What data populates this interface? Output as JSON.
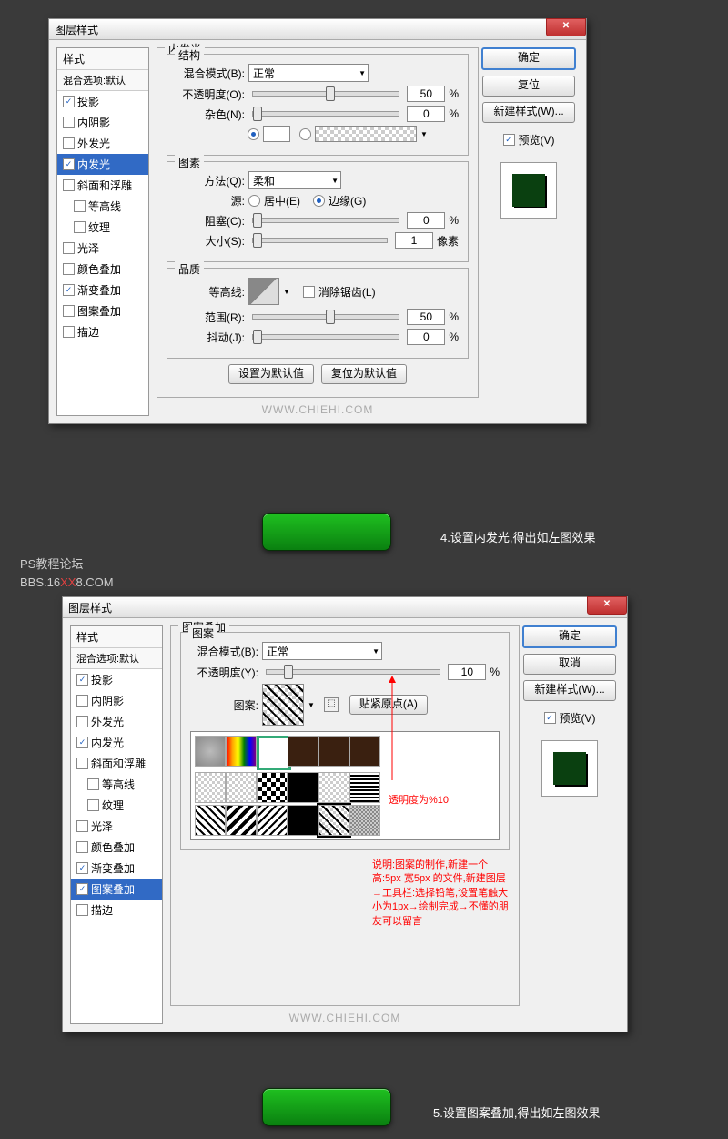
{
  "dialog1": {
    "title": "图层样式",
    "styles_header": "样式",
    "blend_options": "混合选项:默认",
    "items": [
      {
        "label": "投影",
        "checked": true,
        "sel": false
      },
      {
        "label": "内阴影",
        "checked": false,
        "sel": false
      },
      {
        "label": "外发光",
        "checked": false,
        "sel": false
      },
      {
        "label": "内发光",
        "checked": true,
        "sel": true
      },
      {
        "label": "斜面和浮雕",
        "checked": false,
        "sel": false
      },
      {
        "label": "等高线",
        "checked": false,
        "sel": false,
        "indent": true
      },
      {
        "label": "纹理",
        "checked": false,
        "sel": false,
        "indent": true
      },
      {
        "label": "光泽",
        "checked": false,
        "sel": false
      },
      {
        "label": "颜色叠加",
        "checked": false,
        "sel": false
      },
      {
        "label": "渐变叠加",
        "checked": true,
        "sel": false
      },
      {
        "label": "图案叠加",
        "checked": false,
        "sel": false
      },
      {
        "label": "描边",
        "checked": false,
        "sel": false
      }
    ],
    "panel_title": "内发光",
    "struct_title": "结构",
    "blend_mode_label": "混合模式(B):",
    "blend_mode_value": "正常",
    "opacity_label": "不透明度(O):",
    "opacity_value": "50",
    "noise_label": "杂色(N):",
    "noise_value": "0",
    "element_title": "图素",
    "method_label": "方法(Q):",
    "method_value": "柔和",
    "source_label": "源:",
    "source_center": "居中(E)",
    "source_edge": "边缘(G)",
    "choke_label": "阻塞(C):",
    "choke_value": "0",
    "size_label": "大小(S):",
    "size_value": "1",
    "size_unit": "像素",
    "quality_title": "品质",
    "contour_label": "等高线:",
    "antialias_label": "消除锯齿(L)",
    "range_label": "范围(R):",
    "range_value": "50",
    "jitter_label": "抖动(J):",
    "jitter_value": "0",
    "percent": "%",
    "btn_default": "设置为默认值",
    "btn_reset": "复位为默认值",
    "watermark": "WWW.CHIEHI.COM",
    "ok": "确定",
    "reset_btn": "复位",
    "new_style": "新建样式(W)...",
    "preview_chk": "预览(V)"
  },
  "step4_caption": "4.设置内发光,得出如左图效果",
  "forum": {
    "line1": "PS教程论坛",
    "line2a": "BBS.16",
    "line2b": "XX",
    "line2c": "8.COM"
  },
  "dialog2": {
    "title": "图层样式",
    "styles_header": "样式",
    "blend_options": "混合选项:默认",
    "items": [
      {
        "label": "投影",
        "checked": true,
        "sel": false
      },
      {
        "label": "内阴影",
        "checked": false,
        "sel": false
      },
      {
        "label": "外发光",
        "checked": false,
        "sel": false
      },
      {
        "label": "内发光",
        "checked": true,
        "sel": false
      },
      {
        "label": "斜面和浮雕",
        "checked": false,
        "sel": false
      },
      {
        "label": "等高线",
        "checked": false,
        "sel": false,
        "indent": true
      },
      {
        "label": "纹理",
        "checked": false,
        "sel": false,
        "indent": true
      },
      {
        "label": "光泽",
        "checked": false,
        "sel": false
      },
      {
        "label": "颜色叠加",
        "checked": false,
        "sel": false
      },
      {
        "label": "渐变叠加",
        "checked": true,
        "sel": false
      },
      {
        "label": "图案叠加",
        "checked": true,
        "sel": true
      },
      {
        "label": "描边",
        "checked": false,
        "sel": false
      }
    ],
    "panel_title": "图案叠加",
    "pattern_title": "图案",
    "blend_mode_label": "混合模式(B):",
    "blend_mode_value": "正常",
    "opacity_label": "不透明度(Y):",
    "opacity_value": "10",
    "pattern_label": "图案:",
    "snap_origin": "贴紧原点(A)",
    "percent": "%",
    "watermark": "WWW.CHIEHI.COM",
    "ok": "确定",
    "cancel": "取消",
    "new_style": "新建样式(W)...",
    "preview_chk": "预览(V)",
    "note_opacity": "透明度为%10",
    "note_desc": "说明:图案的制作,新建一个高:5px 宽5px 的文件,新建图层→工具栏:选择铅笔,设置笔触大小为1px→绘制完成→不懂的朋友可以留言"
  },
  "step5_caption": "5.设置图案叠加,得出如左图效果"
}
